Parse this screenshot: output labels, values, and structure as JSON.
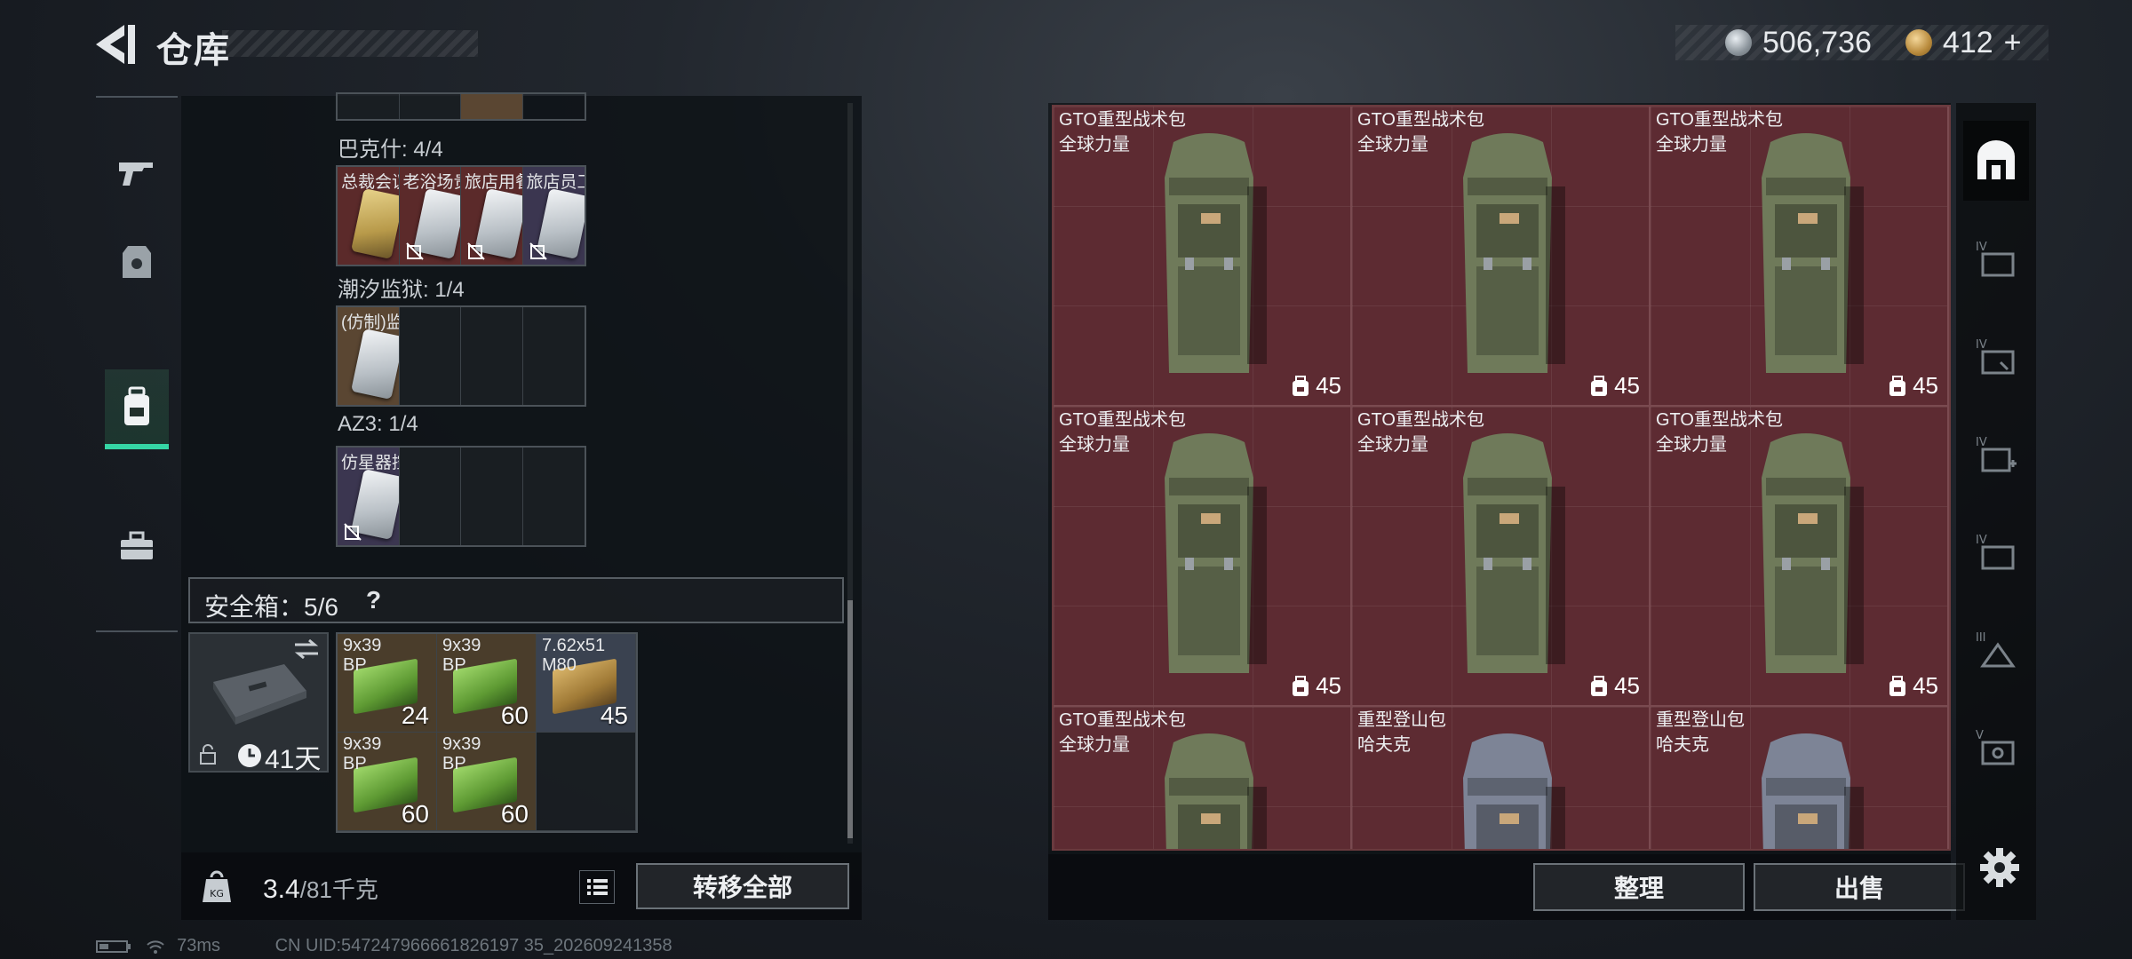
{
  "header": {
    "title": "仓库"
  },
  "currency": {
    "silver": "506,736",
    "gold": "412",
    "add": "+"
  },
  "left_nav": [
    "gun-icon",
    "armor-icon",
    "backpack-icon",
    "toolkit-icon"
  ],
  "groups": [
    {
      "label": "巴克什: 4/4",
      "slots": [
        "总裁会议室",
        "老浴场贵...",
        "旅店用餐间",
        "旅店员工..."
      ]
    },
    {
      "label": "潮汐监狱: 1/4",
      "slots": [
        "(仿制)监..."
      ]
    },
    {
      "label": "AZ3: 1/4",
      "slots": [
        "仿星器控..."
      ]
    }
  ],
  "safe_box": {
    "label": "安全箱：5/6",
    "help": "?",
    "time": "41天"
  },
  "ammo": [
    {
      "name": "9x39\nBP",
      "qty": "24"
    },
    {
      "name": "9x39\nBP",
      "qty": "60"
    },
    {
      "name": "7.62x51\nM80",
      "qty": "45"
    },
    {
      "name": "9x39\nBP",
      "qty": "60"
    },
    {
      "name": "9x39\nBP",
      "qty": "60"
    }
  ],
  "weight": {
    "current": "3.4",
    "max": "/81千克"
  },
  "buttons": {
    "transfer_all": "转移全部",
    "organize": "整理",
    "sell": "出售"
  },
  "status": {
    "ping": "73ms",
    "uid": "CN UID:547247966661826197 35_202609241358"
  },
  "backpacks": [
    {
      "name": "GTO重型战术包",
      "brand": "全球力量",
      "capacity": "45",
      "color": "#6f7a5a"
    },
    {
      "name": "GTO重型战术包",
      "brand": "全球力量",
      "capacity": "45",
      "color": "#6f7a5a"
    },
    {
      "name": "GTO重型战术包",
      "brand": "全球力量",
      "capacity": "45",
      "color": "#6f7a5a"
    },
    {
      "name": "GTO重型战术包",
      "brand": "全球力量",
      "capacity": "45",
      "color": "#6f7a5a"
    },
    {
      "name": "GTO重型战术包",
      "brand": "全球力量",
      "capacity": "45",
      "color": "#6f7a5a"
    },
    {
      "name": "GTO重型战术包",
      "brand": "全球力量",
      "capacity": "45",
      "color": "#6f7a5a"
    },
    {
      "name": "GTO重型战术包",
      "brand": "全球力量",
      "capacity": "",
      "color": "#6f7a5a"
    },
    {
      "name": "重型登山包",
      "brand": "哈夫克",
      "capacity": "",
      "color": "#7d8496"
    },
    {
      "name": "重型登山包",
      "brand": "哈夫克",
      "capacity": "",
      "color": "#7d8496"
    }
  ],
  "right_tabs": [
    "home-icon",
    "IV",
    "IV",
    "IV",
    "IV",
    "III",
    "V"
  ],
  "colors": {
    "accent": "#35d6a5",
    "item_red": "#5d2b32"
  }
}
